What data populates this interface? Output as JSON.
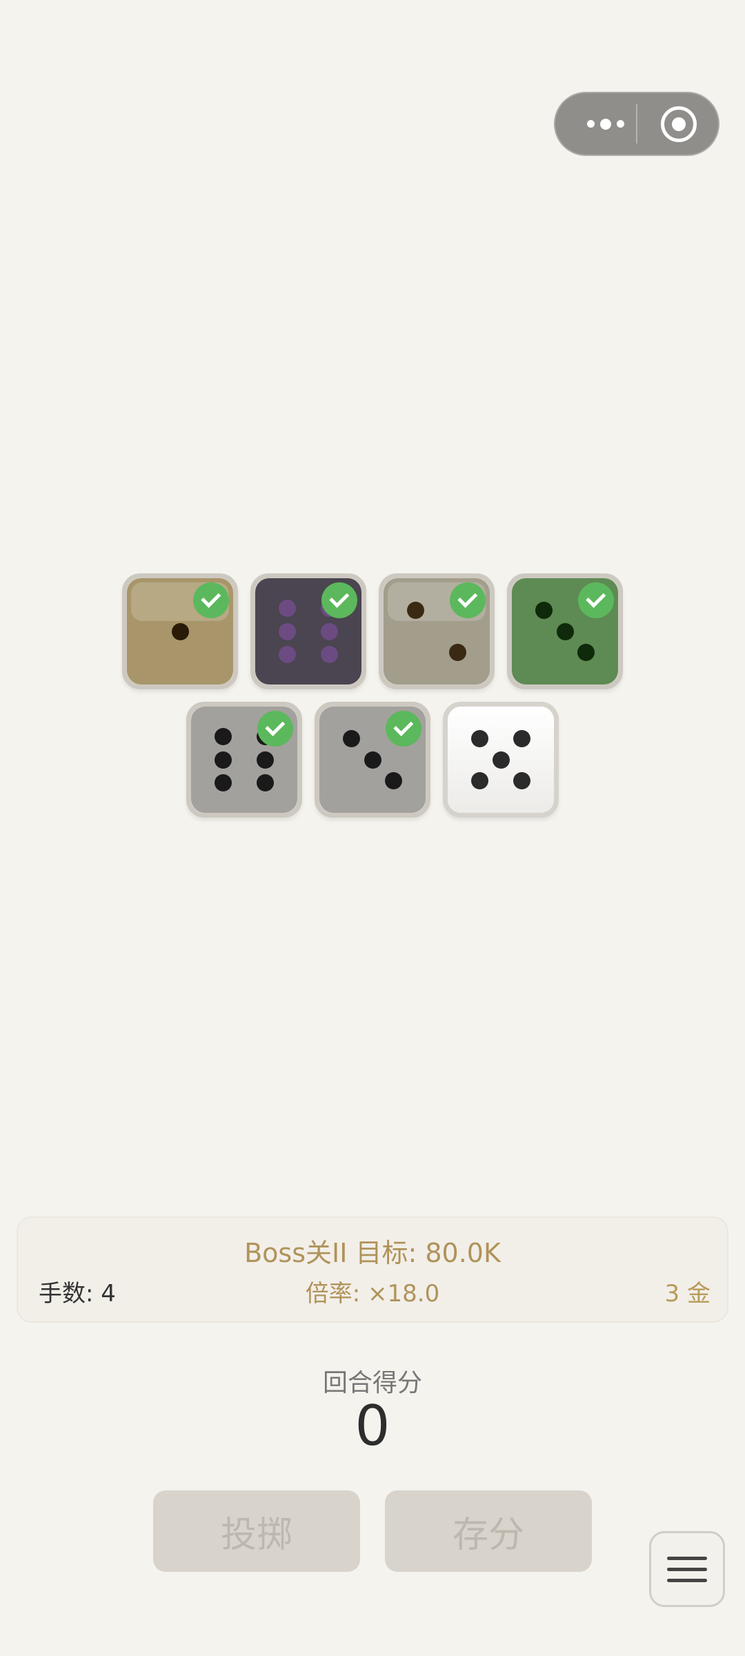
{
  "capsule": {
    "more_icon": "more-dots-icon",
    "close_icon": "record-circle-icon"
  },
  "dice": [
    {
      "value": 1,
      "selected": true,
      "color": "#a8966a"
    },
    {
      "value": 6,
      "selected": true,
      "color": "#4a4550"
    },
    {
      "value": 2,
      "selected": true,
      "color": "#a39e8c"
    },
    {
      "value": 3,
      "selected": true,
      "color": "#5e8a53"
    },
    {
      "value": 6,
      "selected": true,
      "color": "#a3a19d"
    },
    {
      "value": 3,
      "selected": true,
      "color": "#a3a19d"
    },
    {
      "value": 5,
      "selected": false,
      "color": "#ffffff"
    }
  ],
  "panel": {
    "title": "Boss关II  目标: 80.0K",
    "hands": "手数: 4",
    "multiplier": "倍率: ×18.0",
    "gold": "3 金"
  },
  "round": {
    "label": "回合得分",
    "score": "0"
  },
  "buttons": {
    "roll": "投掷",
    "bank": "存分"
  },
  "menu": {
    "icon": "hamburger-menu-icon"
  }
}
